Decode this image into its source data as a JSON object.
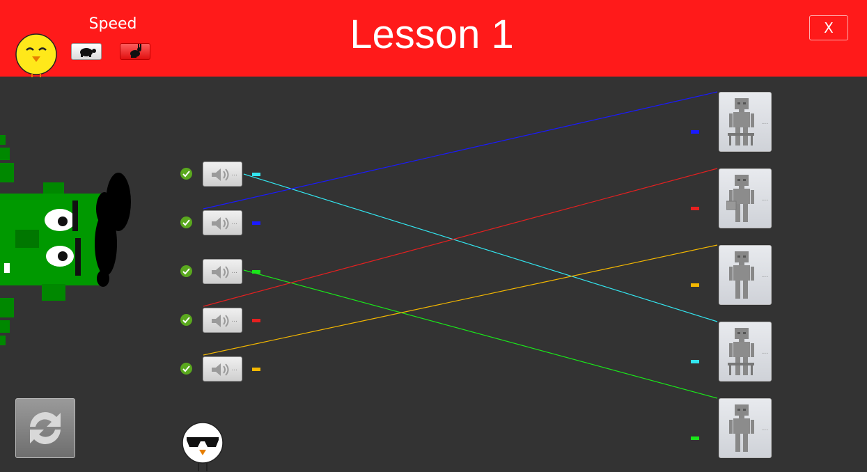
{
  "header": {
    "title": "Lesson 1",
    "speed_label": "Speed",
    "close_label": "X"
  },
  "left_items": [
    {
      "color": "#33e6f0",
      "matched": true
    },
    {
      "color": "#1a1aff",
      "matched": true
    },
    {
      "color": "#1ae61a",
      "matched": true
    },
    {
      "color": "#e62020",
      "matched": true
    },
    {
      "color": "#f5b800",
      "matched": true
    }
  ],
  "right_items": [
    {
      "color": "#1a1aff",
      "icon": "robot-sitting-icon"
    },
    {
      "color": "#e62020",
      "icon": "robot-with-box-icon"
    },
    {
      "color": "#f5b800",
      "icon": "robot-standing-icon"
    },
    {
      "color": "#33e6f0",
      "icon": "robot-sitting-icon"
    },
    {
      "color": "#1ae61a",
      "icon": "robot-standing-icon"
    }
  ],
  "connections": [
    {
      "from": 0,
      "to": 3,
      "color": "#33e6f0"
    },
    {
      "from": 1,
      "to": 0,
      "color": "#1a1aff"
    },
    {
      "from": 2,
      "to": 4,
      "color": "#1ae61a"
    },
    {
      "from": 3,
      "to": 1,
      "color": "#e62020"
    },
    {
      "from": 4,
      "to": 2,
      "color": "#f5b800"
    }
  ],
  "button_dots": "...",
  "colors": {
    "header": "#ff1a1a",
    "background": "#333333",
    "check": "#5aa81e"
  }
}
